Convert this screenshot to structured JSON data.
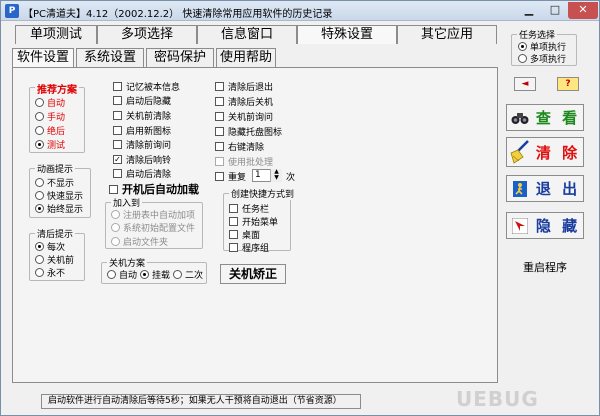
{
  "window": {
    "title": "【PC清道夫】4.12（2002.12.2） 快速清除常用应用软件的历史记录",
    "icon_letter": "P"
  },
  "top_tabs": [
    "单项测试",
    "多项选择",
    "信息窗口",
    "特殊设置",
    "其它应用"
  ],
  "sub_tabs": [
    "软件设置",
    "系统设置",
    "密码保护",
    "使用帮助"
  ],
  "recommend": {
    "title": "推荐方案",
    "options": [
      "自动",
      "手动",
      "绝后",
      "测试"
    ],
    "selected": 3
  },
  "animation": {
    "title": "动画提示",
    "options": [
      "不显示",
      "快速显示",
      "始终显示"
    ],
    "selected": 2
  },
  "after_clean": {
    "title": "清后提示",
    "options": [
      "每次",
      "关机前",
      "永不"
    ],
    "selected": 0
  },
  "mid_checks": [
    "记忆被本信息",
    "启动后隐藏",
    "关机前清除",
    "启用新图标",
    "清除前询问",
    "清除后响铃",
    "启动后清除"
  ],
  "mid_checks_checked": [
    5
  ],
  "autorun": {
    "label": "开机后自动加载",
    "group_title": "加入到",
    "options": [
      "注册表中自动加项",
      "系统初始配置文件",
      "启动文件夹"
    ]
  },
  "shutdown": {
    "title": "关机方案",
    "options": [
      "自动",
      "挂载",
      "二次"
    ],
    "selected": 1
  },
  "shutdown_button": "关机矫正",
  "right_checks": [
    "清除后退出",
    "清除后关机",
    "关机前询问",
    "隐藏托盘图标",
    "右键清除",
    "使用批处理"
  ],
  "repeat": {
    "label": "重复",
    "value": "1",
    "unit": "次"
  },
  "shortcuts": {
    "title": "创建快捷方式到",
    "options": [
      "任务栏",
      "开始菜单",
      "桌面",
      "程序组"
    ]
  },
  "task": {
    "title": "任务选择",
    "options": [
      "单项执行",
      "多项执行"
    ],
    "selected": 0
  },
  "buttons": {
    "back": "◄",
    "help": "?",
    "view": "查 看",
    "clear": "清 除",
    "exit": "退 出",
    "hide": "隐 藏",
    "restart": "重启程序"
  },
  "status_text": "启动软件进行自动清除后等待5秒；如果无人干预将自动退出（节省资源）",
  "watermark": "UEBUG"
}
